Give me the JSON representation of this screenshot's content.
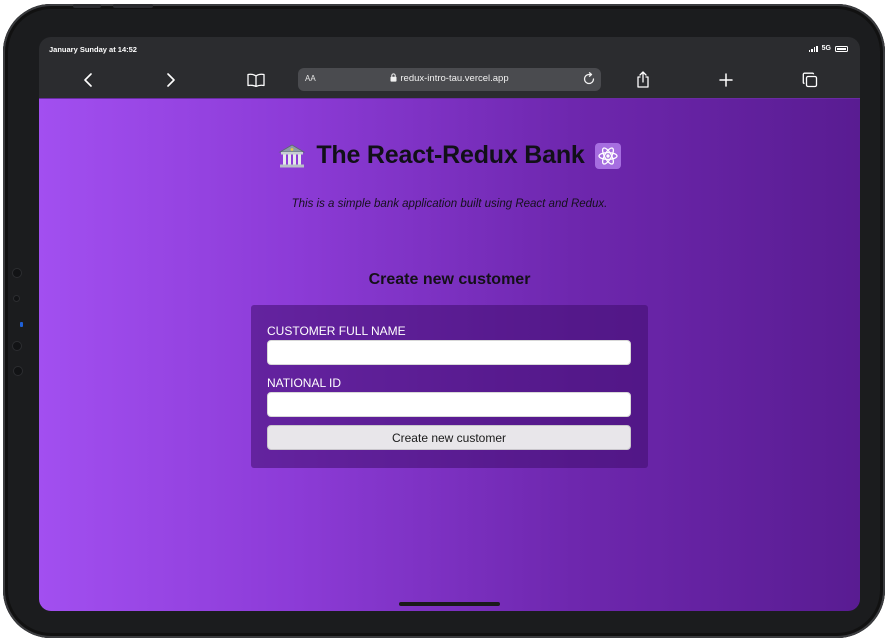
{
  "status": {
    "time": "January Sunday at 14:52",
    "network": "5G"
  },
  "browser": {
    "reader_label": "AA",
    "url": "redux-intro-tau.vercel.app",
    "icons": [
      "back-icon",
      "forward-icon",
      "bookmarks-icon",
      "lock-icon",
      "reload-icon",
      "share-icon",
      "new-tab-icon",
      "tabs-icon"
    ]
  },
  "page": {
    "title": "The React-Redux Bank",
    "title_icons": [
      "bank-icon",
      "atom-icon"
    ],
    "subtitle": "This is a simple bank application built using React and Redux.",
    "section_title": "Create new customer",
    "form": {
      "name_label": "CUSTOMER FULL NAME",
      "name_value": "",
      "id_label": "NATIONAL ID",
      "id_value": "",
      "submit_label": "Create new customer"
    }
  },
  "colors": {
    "gradient_start": "#a24ff0",
    "gradient_end": "#591c92",
    "chrome": "#2b2c2f",
    "url_field": "#4a4b4f"
  }
}
